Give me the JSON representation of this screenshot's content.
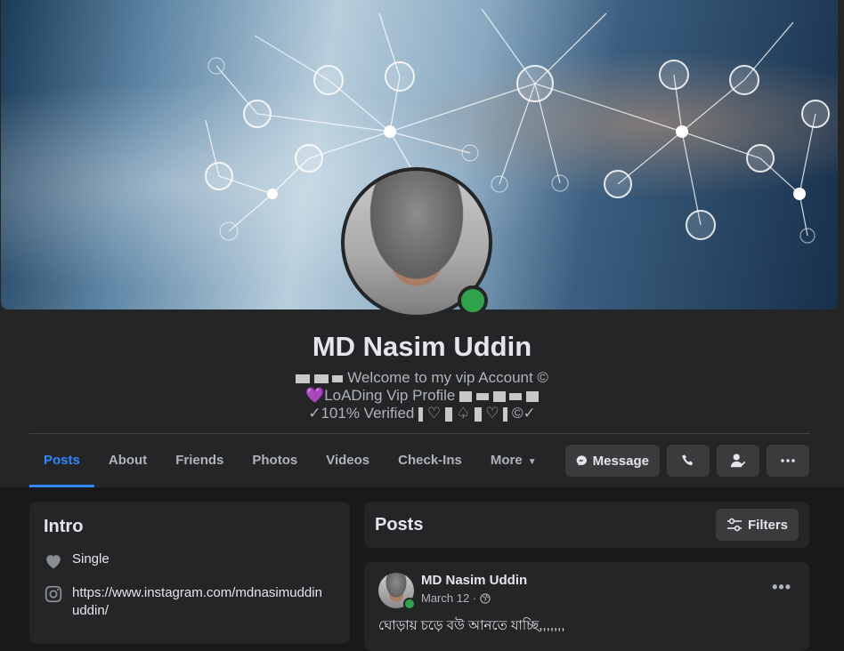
{
  "profile": {
    "name": "MD Nasim Uddin",
    "bio_line1": "Welcome to my vip Account ©",
    "bio_line2_heart": "💜",
    "bio_line2": "LoADing Vip Profile",
    "bio_line3": "✓101% Verified",
    "bio_line3_a": "♡",
    "bio_line3_b": "♤",
    "bio_line3_c": "♡",
    "bio_line3_d": "©✓",
    "online": true
  },
  "tabs": [
    {
      "label": "Posts",
      "active": true
    },
    {
      "label": "About"
    },
    {
      "label": "Friends"
    },
    {
      "label": "Photos"
    },
    {
      "label": "Videos"
    },
    {
      "label": "Check-Ins"
    },
    {
      "label": "More"
    }
  ],
  "actions": {
    "message_label": "Message",
    "call_icon": "phone-icon",
    "friend_icon": "friend-check-icon",
    "more_icon": "more-horizontal-icon"
  },
  "intro": {
    "title": "Intro",
    "relationship": "Single",
    "instagram": "https://www.instagram.com/mdnasimuddinuddin/"
  },
  "posts_section": {
    "title": "Posts",
    "filters_label": "Filters"
  },
  "post": {
    "author": "MD Nasim Uddin",
    "date": "March 12 ·",
    "text": "ঘোড়ায় চড়ে বউ আনতে যাচ্ছি,,,,,,,"
  },
  "colors": {
    "background": "#18191a",
    "surface": "#242526",
    "button": "#3a3b3c",
    "accent": "#2d88ff",
    "online": "#31a24c",
    "text_primary": "#e4e6eb",
    "text_secondary": "#b0b3b8"
  }
}
